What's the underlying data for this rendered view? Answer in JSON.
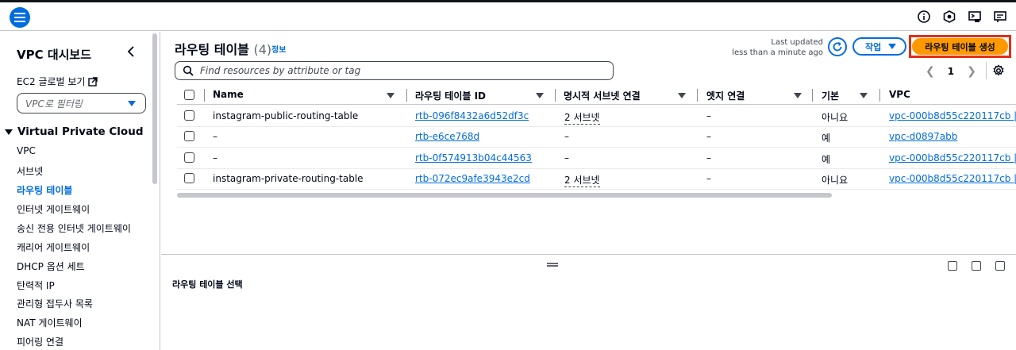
{
  "topbar": {
    "menu_icon": "hamburger-icon",
    "icons": [
      "info-icon",
      "notification-icon",
      "cloudshell-icon",
      "feedback-icon"
    ]
  },
  "sidebar": {
    "title": "VPC 대시보드",
    "ec2_link": "EC2 글로벌 보기",
    "filter_placeholder": "VPC로 필터링",
    "section": "Virtual Private Cloud",
    "items": [
      {
        "label": "VPC"
      },
      {
        "label": "서브넷"
      },
      {
        "label": "라우팅 테이블",
        "active": true
      },
      {
        "label": "인터넷 게이트웨이"
      },
      {
        "label": "송신 전용 인터넷 게이트웨이"
      },
      {
        "label": "캐리어 게이트웨이"
      },
      {
        "label": "DHCP 옵션 세트"
      },
      {
        "label": "탄력적 IP"
      },
      {
        "label": "관리형 접두사 목록"
      },
      {
        "label": "NAT 게이트웨이"
      },
      {
        "label": "피어링 연결"
      }
    ]
  },
  "main": {
    "title": "라우팅 테이블",
    "count": "(4)",
    "info": "정보",
    "last_updated_label": "Last updated",
    "last_updated_value": "less than a minute ago",
    "action_label": "작업",
    "create_label": "라우팅 테이블 생성",
    "search_placeholder": "Find resources by attribute or tag",
    "page": "1",
    "columns": [
      "Name",
      "라우팅 테이블 ID",
      "명시적 서브넷 연결",
      "엣지 연결",
      "기본",
      "VPC"
    ],
    "rows": [
      {
        "name": "instagram-public-routing-table",
        "id": "rtb-096f8432a6d52df3c",
        "subnets": "2 서브넷",
        "edge": "–",
        "main": "아니요",
        "vpc": "vpc-000b8d55c220117cb |"
      },
      {
        "name": "–",
        "id": "rtb-e6ce768d",
        "subnets": "–",
        "edge": "–",
        "main": "예",
        "vpc": "vpc-d0897abb"
      },
      {
        "name": "–",
        "id": "rtb-0f574913b04c44563",
        "subnets": "–",
        "edge": "–",
        "main": "예",
        "vpc": "vpc-000b8d55c220117cb |"
      },
      {
        "name": "instagram-private-routing-table",
        "id": "rtb-072ec9afe3943e2cd",
        "subnets": "2 서브넷",
        "edge": "–",
        "main": "아니요",
        "vpc": "vpc-000b8d55c220117cb |"
      }
    ]
  },
  "split": {
    "title": "라우팅 테이블 선택"
  },
  "colors": {
    "accent": "#006ce0",
    "primary_button": "#ff9900",
    "highlight_border": "#e52e14"
  }
}
